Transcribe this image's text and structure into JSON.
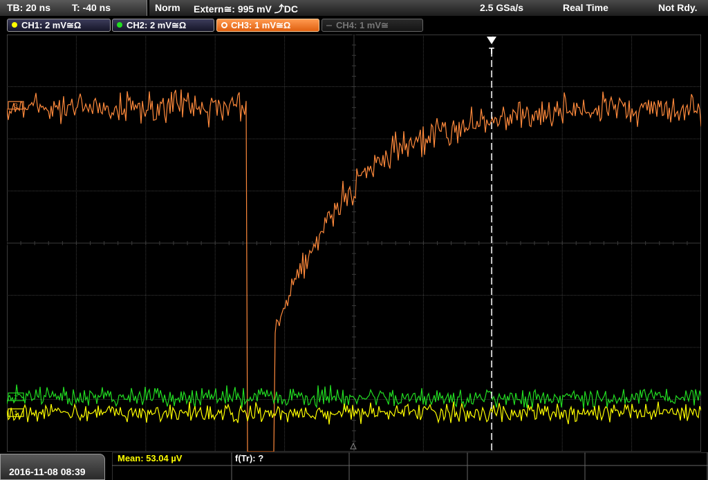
{
  "header": {
    "timebase": "TB: 20 ns",
    "trigger_time": "T: -40 ns",
    "trigger_mode": "Norm",
    "trigger_source": "Extern≅: 995 mV ⤴DC",
    "sample_rate": "2.5 GSa/s",
    "acq_mode": "Real Time",
    "status": "Not Rdy."
  },
  "channels": [
    {
      "label": "CH1: 2 mV≅Ω",
      "color": "#ffff00",
      "state": "on"
    },
    {
      "label": "CH2: 2 mV≅Ω",
      "color": "#22dd22",
      "state": "on"
    },
    {
      "label": "CH3: 1 mV≅Ω",
      "color": "#ff8a3c",
      "state": "active"
    },
    {
      "label": "CH4: 1 mV≅",
      "color": "#666666",
      "state": "off"
    }
  ],
  "plot": {
    "trigger_marker_label": "T",
    "ch_marker_icons": [
      "ch3-offset-marker-icon",
      "ch2-offset-marker-icon",
      "ch1-offset-marker-icon"
    ]
  },
  "footer": {
    "datetime": "2016-11-08 08:39",
    "mean_measurement": "Mean: 53.04 µV",
    "frequency_measurement": "f(Tr): ?"
  },
  "colors": {
    "ch1": "#ffff00",
    "ch2": "#22dd22",
    "ch3": "#ff8a3c",
    "grid": "#444444",
    "background": "#000000"
  }
}
